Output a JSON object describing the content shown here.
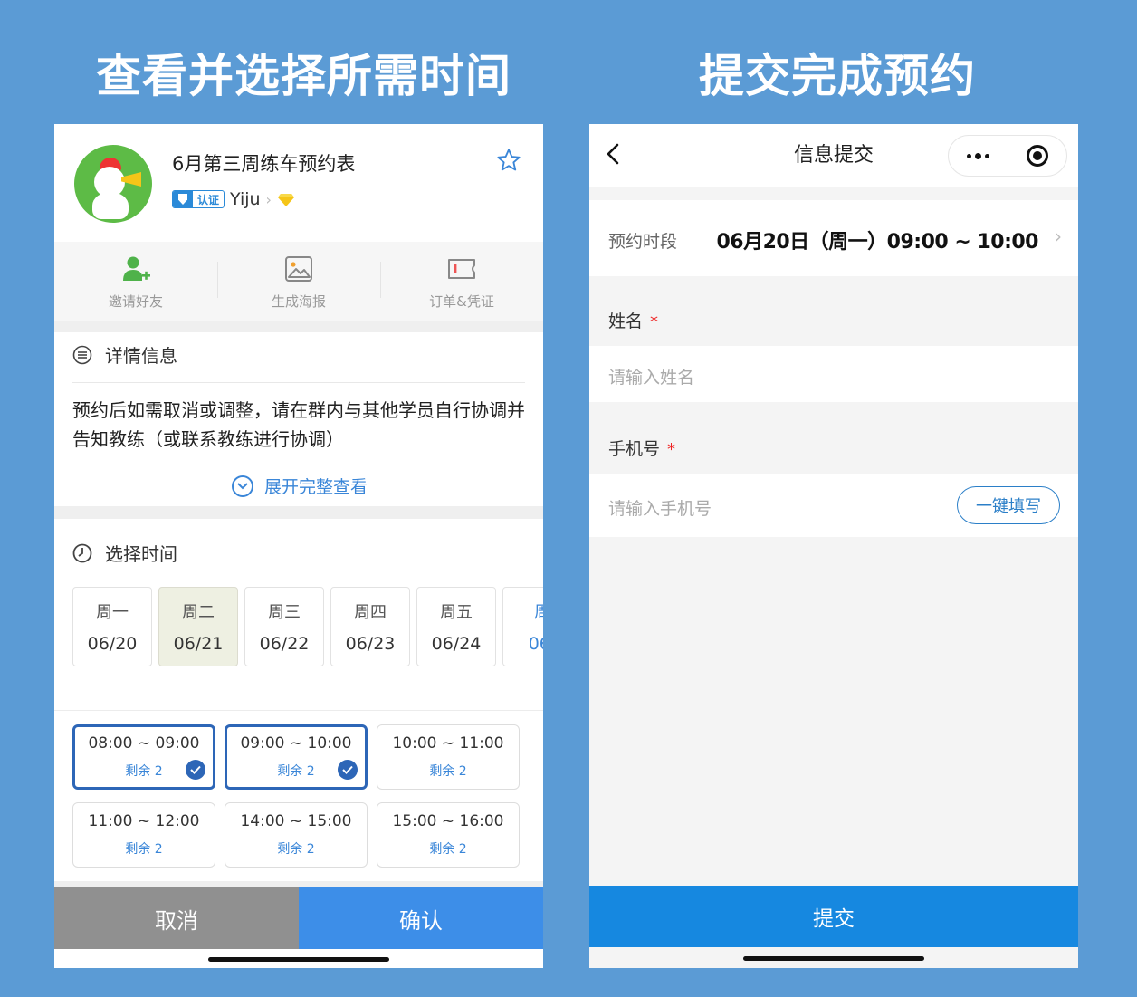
{
  "captions": {
    "left": "查看并选择所需时间",
    "right": "提交完成预约"
  },
  "left_screen": {
    "title": "6月第三周练车预约表",
    "badge_label": "认证",
    "owner": "Yiju",
    "owner_chevron": "›",
    "actions": [
      {
        "label": "邀请好友",
        "icon": "add-user-icon"
      },
      {
        "label": "生成海报",
        "icon": "image-icon"
      },
      {
        "label": "订单&凭证",
        "icon": "ticket-icon"
      }
    ],
    "details": {
      "heading": "详情信息",
      "text": "预约后如需取消或调整，请在群内与其他学员自行协调并告知教练（或联系教练进行协调）",
      "expand_label": "展开完整查看"
    },
    "select_time": {
      "heading": "选择时间",
      "days": [
        {
          "name": "周一",
          "date": "06/20"
        },
        {
          "name": "周二",
          "date": "06/21"
        },
        {
          "name": "周三",
          "date": "06/22"
        },
        {
          "name": "周四",
          "date": "06/23"
        },
        {
          "name": "周五",
          "date": "06/24"
        },
        {
          "name": "周",
          "date": "06/"
        }
      ],
      "active_day": "周二",
      "slots": [
        {
          "time": "08:00 ~ 09:00",
          "remaining": "剩余 2",
          "selected": true
        },
        {
          "time": "09:00 ~ 10:00",
          "remaining": "剩余 2",
          "selected": true
        },
        {
          "time": "10:00 ~ 11:00",
          "remaining": "剩余 2",
          "selected": false
        },
        {
          "time": "11:00 ~ 12:00",
          "remaining": "剩余 2",
          "selected": false
        },
        {
          "time": "14:00 ~ 15:00",
          "remaining": "剩余 2",
          "selected": false
        },
        {
          "time": "15:00 ~ 16:00",
          "remaining": "剩余 2",
          "selected": false
        }
      ]
    },
    "cancel_label": "取消",
    "confirm_label": "确认"
  },
  "right_screen": {
    "nav_title": "信息提交",
    "slot_row": {
      "label": "预约时段",
      "value": "06月20日（周一）09:00 ~ 10:00",
      "chevron": "›"
    },
    "name_field": {
      "label": "姓名",
      "required_mark": "*",
      "placeholder": "请输入姓名"
    },
    "phone_field": {
      "label": "手机号",
      "required_mark": "*",
      "placeholder": "请输入手机号",
      "autofill_label": "一键填写"
    },
    "submit_label": "提交"
  },
  "colors": {
    "background": "#5b9bd5",
    "accent_blue": "#3d8ee8",
    "submit_blue": "#1688e0",
    "selected_border": "#2d66b7",
    "cancel_gray": "#909090",
    "avatar_green": "#5dbb46",
    "required_red": "#e22"
  }
}
